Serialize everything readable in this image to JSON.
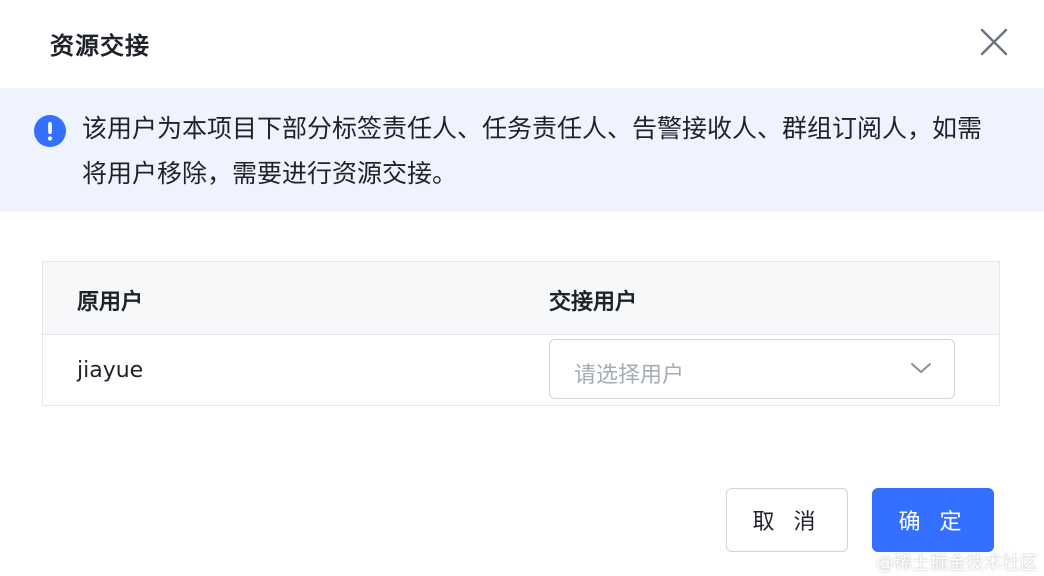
{
  "dialog": {
    "title": "资源交接",
    "alert": {
      "text": "该用户为本项目下部分标签责任人、任务责任人、告警接收人、群组订阅人，如需将用户移除，需要进行资源交接。"
    },
    "table": {
      "columns": [
        "原用户",
        "交接用户"
      ],
      "rows": [
        {
          "original_user": "jiayue",
          "handover_placeholder": "请选择用户"
        }
      ]
    },
    "buttons": {
      "cancel": "取 消",
      "confirm": "确 定"
    }
  },
  "watermark": "@稀土掘金技术社区",
  "icons": {
    "close": "close-icon",
    "alert": "exclamation-circle-icon",
    "dropdown": "chevron-down-icon"
  },
  "colors": {
    "primary": "#3370ff",
    "alert_bg": "#eef3fd",
    "alert_icon": "#3370ff",
    "text": "#1f2329",
    "placeholder": "#a6abb4",
    "border": "#d0d3d9"
  }
}
